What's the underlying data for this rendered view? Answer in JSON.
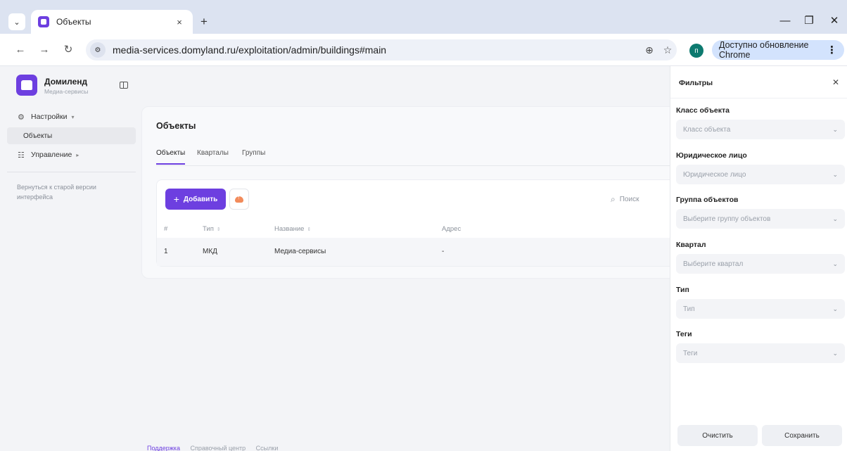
{
  "browser": {
    "tab": {
      "title": "Объекты",
      "close": "×"
    },
    "new_tab": "+",
    "window_controls": {
      "minimize": "—",
      "restore": "❐",
      "close": "✕"
    },
    "nav": {
      "back": "←",
      "forward": "→",
      "reload": "↻"
    },
    "url": "media-services.domyland.ru/exploitation/admin/buildings#main",
    "profile_initial": "п",
    "update_label": "Доступно обновление Chrome",
    "kebab": "⋮"
  },
  "sidebar": {
    "brand_name": "Домиленд",
    "brand_sub": "Медиа-сервисы",
    "items": [
      {
        "label": "Настройки",
        "icon": "gear-icon",
        "caret": "▾"
      },
      {
        "label": "Объекты"
      },
      {
        "label": "Управление",
        "icon": "grid-list-icon",
        "caret": "▸"
      }
    ],
    "old_version": "Вернуться к старой версии интерфейса"
  },
  "main": {
    "title": "Объекты",
    "tabs": [
      {
        "label": "Объекты"
      },
      {
        "label": "Кварталы"
      },
      {
        "label": "Группы"
      }
    ],
    "add_label": "Добавить",
    "search_placeholder": "Поиск",
    "columns": [
      "#",
      "Тип",
      "Название",
      "Адрес"
    ],
    "rows": [
      {
        "num": "1",
        "type": "МКД",
        "name": "Медиа-сервисы",
        "address": "-"
      }
    ]
  },
  "footer": {
    "links": [
      "Поддержка",
      "Справочный центр",
      "Ссылки"
    ]
  },
  "filters": {
    "title": "Фильтры",
    "fields": [
      {
        "label": "Класс объекта",
        "placeholder": "Класс объекта"
      },
      {
        "label": "Юридическое лицо",
        "placeholder": "Юридическое лицо"
      },
      {
        "label": "Группа объектов",
        "placeholder": "Выберите группу объектов"
      },
      {
        "label": "Квартал",
        "placeholder": "Выберите квартал"
      },
      {
        "label": "Тип",
        "placeholder": "Тип"
      },
      {
        "label": "Теги",
        "placeholder": "Теги"
      }
    ],
    "clear_label": "Очистить",
    "save_label": "Сохранить"
  },
  "colors": {
    "accent": "#6d3fe0",
    "upload": "#f28b5b",
    "profile": "#0d7a6f",
    "update": "#d3e3fd"
  }
}
